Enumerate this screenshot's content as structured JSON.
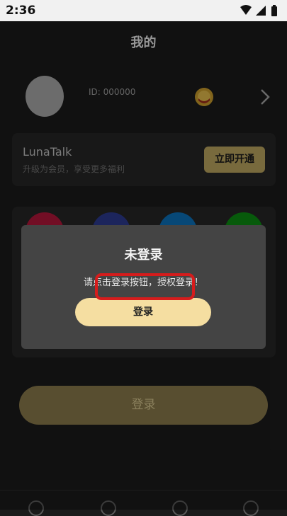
{
  "status_bar": {
    "time": "2:36"
  },
  "header": {
    "title": "我的"
  },
  "profile": {
    "id_text": "ID: 000000"
  },
  "vip": {
    "title": "LunaTalk",
    "subtitle": "升级为会员，享受更多福利",
    "button_label": "立即开通"
  },
  "features": {
    "colors": [
      "#b0163a",
      "#2c3a8e",
      "#0c6fb7",
      "#0c8b12"
    ]
  },
  "main": {
    "login_label": "登录"
  },
  "dialog": {
    "title": "未登录",
    "message": "请点击登录按钮，授权登录！",
    "login_label": "登录"
  },
  "colors": {
    "accent_gold": "#b8a35e",
    "dialog_button": "#f5dea1",
    "highlight": "#d61c1c"
  }
}
